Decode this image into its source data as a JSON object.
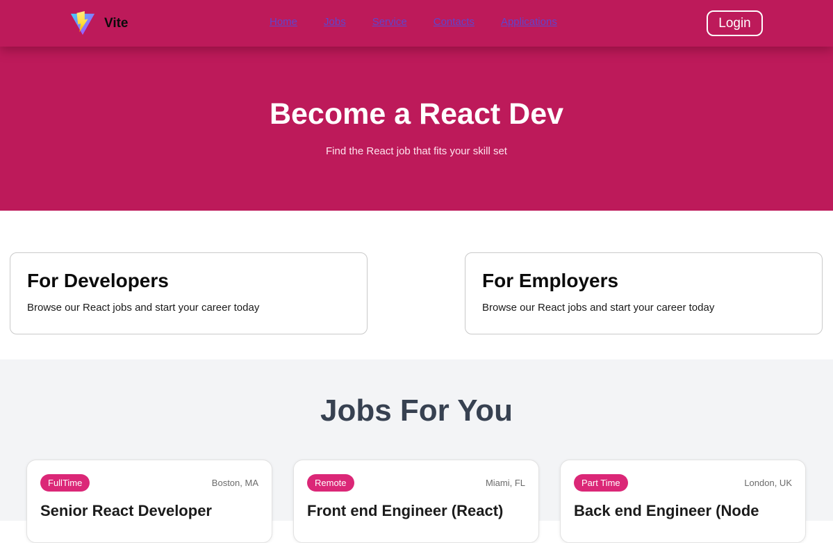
{
  "brand": {
    "name": "Vite",
    "logo_icon": "vite-logo-icon"
  },
  "nav": {
    "links": [
      "Home",
      "Jobs",
      "Service",
      "Contacts",
      "Applications"
    ],
    "login_label": "Login"
  },
  "hero": {
    "title": "Become a React Dev",
    "subtitle": "Find the React job that fits your skill set"
  },
  "info_cards": [
    {
      "title": "For Developers",
      "text": "Browse our React jobs and start your career today"
    },
    {
      "title": "For Employers",
      "text": "Browse our React jobs and start your career today"
    }
  ],
  "jobs": {
    "heading": "Jobs For You",
    "items": [
      {
        "type": "FullTime",
        "location": "Boston, MA",
        "title": "Senior React Developer"
      },
      {
        "type": "Remote",
        "location": "Miami, FL",
        "title": "Front end Engineer (React)"
      },
      {
        "type": "Part Time",
        "location": "London, UK",
        "title": "Back end Engineer (Node"
      }
    ]
  },
  "colors": {
    "brand_primary": "#bd1a5a",
    "badge": "#db2777",
    "nav_link": "#5f45cc",
    "jobs_background": "#f3f4f6",
    "jobs_heading": "#374151"
  }
}
